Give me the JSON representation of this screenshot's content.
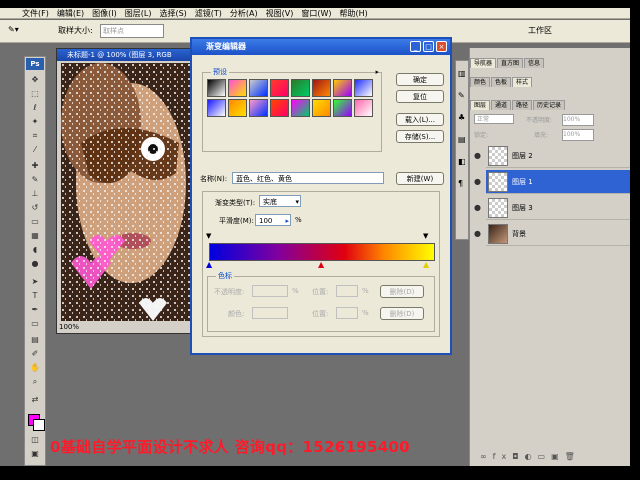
{
  "menubar": {
    "items": [
      "文件(F)",
      "编辑(E)",
      "图像(I)",
      "图层(L)",
      "选择(S)",
      "滤镜(T)",
      "分析(A)",
      "视图(V)",
      "窗口(W)",
      "帮助(H)"
    ]
  },
  "options": {
    "sample_size_label": "取样大小:",
    "sample_value": "取样点",
    "workspace_label": "工作区"
  },
  "toolbox": {
    "logo": "Ps"
  },
  "document": {
    "title": "未标题-1 @ 100% (图层 3, RGB",
    "zoom": "100%"
  },
  "dialog": {
    "title": "渐变编辑器",
    "presets_label": "预设",
    "buttons": {
      "ok": "确定",
      "reset": "复位",
      "load": "载入(L)...",
      "save": "存储(S)...",
      "new": "新建(W)"
    },
    "name_label": "名称(N):",
    "name_value": "蓝色、红色、黄色",
    "gradient_type_label": "渐变类型(T):",
    "gradient_type_value": "实底",
    "smoothness_label": "平滑度(M):",
    "smoothness_value": "100",
    "smoothness_unit": "%",
    "stops_label": "色标",
    "opacity_label": "不透明度:",
    "position_label": "位置:",
    "color_label": "颜色:",
    "delete_label": "删除(D)",
    "percent": "%",
    "preset_colors": [
      "#000000",
      "#ff4fd2",
      "#cccccc",
      "#ff3b2a",
      "#2a7a2a",
      "#a01818",
      "#ffcc00",
      "#2030ff",
      "#1a1aff",
      "#ff8800",
      "#ff99cc",
      "#ff4400",
      "#ff00ff",
      "#ffdd00",
      "#30ff30",
      "#ff66aa"
    ]
  },
  "panels": {
    "tabs_top": [
      "导航器",
      "直方图",
      "信息"
    ],
    "tabs_mid": [
      "颜色",
      "色板",
      "样式"
    ],
    "tabs_layers": [
      "图层",
      "通道",
      "路径",
      "历史记录"
    ],
    "blend_mode": "正常",
    "opacity_label": "不透明度:",
    "opacity_value": "100%",
    "fill_label": "填充:",
    "fill_value": "100%",
    "lock_label": "锁定:",
    "layers": [
      {
        "name": "图层 2",
        "selected": false
      },
      {
        "name": "图层 1",
        "selected": true
      },
      {
        "name": "图层 3",
        "selected": false
      },
      {
        "name": "背景",
        "selected": false
      }
    ]
  },
  "watermark": "0基础自学平面设计不求人 咨询qq：1526195400"
}
